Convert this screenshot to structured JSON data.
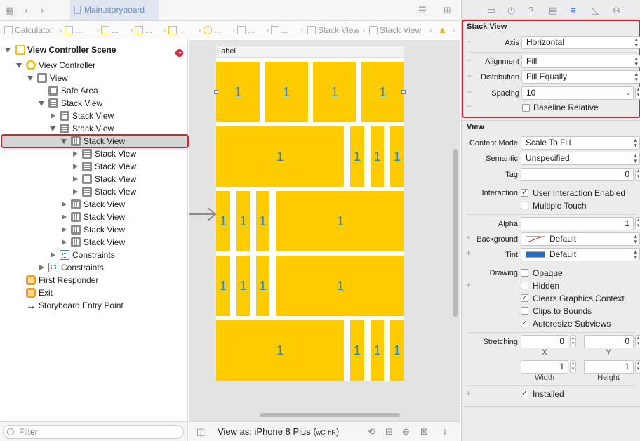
{
  "toolbar": {
    "file_tab": "Main.storyboard"
  },
  "breadcrumbs": [
    "Calculator",
    "...",
    "...",
    "...",
    "...",
    "...",
    "...",
    "Stack View",
    "Stack View"
  ],
  "outline": {
    "items": [
      {
        "label": "View Controller Scene",
        "bold": true
      },
      {
        "label": "View Controller"
      },
      {
        "label": "View"
      },
      {
        "label": "Safe Area"
      },
      {
        "label": "Stack View"
      },
      {
        "label": "Stack View"
      },
      {
        "label": "Stack View"
      },
      {
        "label": "Stack View",
        "selected": true
      },
      {
        "label": "Stack View"
      },
      {
        "label": "Stack View"
      },
      {
        "label": "Stack View"
      },
      {
        "label": "Stack View"
      },
      {
        "label": "Stack View"
      },
      {
        "label": "Stack View"
      },
      {
        "label": "Stack View"
      },
      {
        "label": "Stack View"
      },
      {
        "label": "Constraints"
      },
      {
        "label": "Constraints"
      },
      {
        "label": "First Responder"
      },
      {
        "label": "Exit"
      },
      {
        "label": "Storyboard Entry Point"
      }
    ],
    "filter_placeholder": "Filter"
  },
  "canvas": {
    "label_text": "Label",
    "cell_text": "1",
    "view_as": "View as: iPhone 8 Plus (",
    "size_class_w": "wC",
    "size_class_h": "hR",
    "view_as_close": ")",
    "accent_color": "#ffcc00"
  },
  "inspector": {
    "stack_view": {
      "title": "Stack View",
      "axis_label": "Axis",
      "axis_value": "Horizontal",
      "alignment_label": "Alignment",
      "alignment_value": "Fill",
      "distribution_label": "Distribution",
      "distribution_value": "Fill Equally",
      "spacing_label": "Spacing",
      "spacing_value": "10",
      "baseline_label": "Baseline Relative"
    },
    "view": {
      "title": "View",
      "content_mode_label": "Content Mode",
      "content_mode_value": "Scale To Fill",
      "semantic_label": "Semantic",
      "semantic_value": "Unspecified",
      "tag_label": "Tag",
      "tag_value": "0",
      "interaction_label": "Interaction",
      "user_interaction": "User Interaction Enabled",
      "multiple_touch": "Multiple Touch",
      "alpha_label": "Alpha",
      "alpha_value": "1",
      "background_label": "Background",
      "background_value": "Default",
      "tint_label": "Tint",
      "tint_value": "Default",
      "drawing_label": "Drawing",
      "opaque": "Opaque",
      "hidden": "Hidden",
      "clears_graphics": "Clears Graphics Context",
      "clips_to_bounds": "Clips to Bounds",
      "autoresize": "Autoresize Subviews",
      "stretching_label": "Stretching",
      "stretch_x": "0",
      "stretch_y": "0",
      "x_label": "X",
      "y_label": "Y",
      "stretch_w": "1",
      "stretch_h": "1",
      "width_label": "Width",
      "height_label": "Height",
      "installed": "Installed"
    },
    "tint_color": "#1a6fd6"
  }
}
